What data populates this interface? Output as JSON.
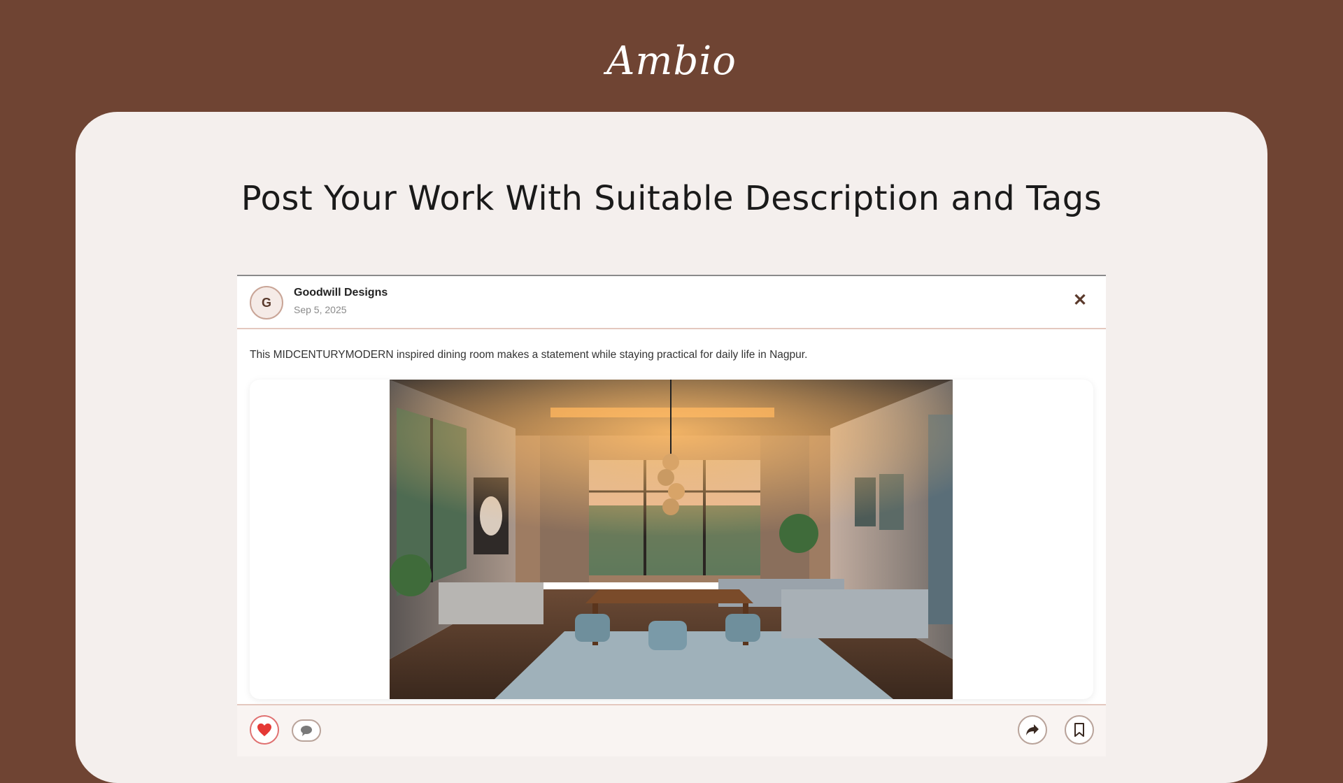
{
  "app": {
    "logo_text": "Ambio"
  },
  "page": {
    "headline": "Post Your Work With Suitable Description and Tags"
  },
  "post": {
    "avatar_initial": "G",
    "author": "Goodwill Designs",
    "date": "Sep 5, 2025",
    "description": "This MIDCENTURYMODERN inspired dining room makes a statement while staying practical for daily life in Nagpur.",
    "close_icon": "close-icon",
    "image_subject": "mid-century modern dining room"
  },
  "actions": {
    "like_icon": "heart-icon",
    "comment_icon": "speech-bubble-icon",
    "share_icon": "share-arrow-icon",
    "save_icon": "bookmark-icon"
  },
  "colors": {
    "background": "#6f4433",
    "panel": "#f4efed",
    "like_active": "#e53935",
    "accent_border": "#e4c8bf"
  }
}
